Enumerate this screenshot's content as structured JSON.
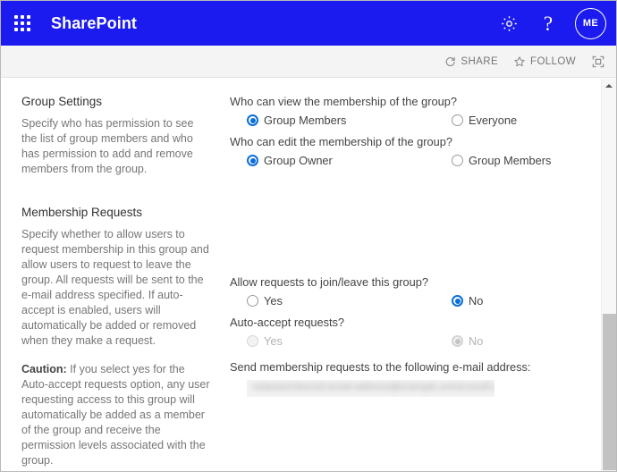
{
  "suite_bar": {
    "waffle_icon": "app-launcher-icon",
    "brand": "SharePoint",
    "settings_icon": "gear-icon",
    "help_icon": "question-mark-icon",
    "avatar_initials": "ME",
    "background_color": "#1b1bf0"
  },
  "command_bar": {
    "share_label": "SHARE",
    "share_icon": "share-icon",
    "follow_label": "FOLLOW",
    "follow_icon": "star-icon",
    "focus_icon": "focus-on-content-icon"
  },
  "sections": {
    "group_settings": {
      "title": "Group Settings",
      "description": "Specify who has permission to see the list of group members and who has permission to add and remove members from the group."
    },
    "membership_requests": {
      "title": "Membership Requests",
      "description": "Specify whether to allow users to request membership in this group and allow users to request to leave the group. All requests will be sent to the e-mail address specified. If auto-accept is enabled, users will automatically be added or removed when they make a request.",
      "caution_label": "Caution:",
      "caution_text": " If you select yes for the Auto-accept requests option, any user requesting access to this group will automatically be added as a member of the group and receive the permission levels associated with the group."
    }
  },
  "fields": {
    "view_membership": {
      "question": "Who can view the membership of the group?",
      "options": [
        {
          "label": "Group Members",
          "selected": true,
          "disabled": false
        },
        {
          "label": "Everyone",
          "selected": false,
          "disabled": false
        }
      ]
    },
    "edit_membership": {
      "question": "Who can edit the membership of the group?",
      "options": [
        {
          "label": "Group Owner",
          "selected": true,
          "disabled": false
        },
        {
          "label": "Group Members",
          "selected": false,
          "disabled": false
        }
      ]
    },
    "allow_requests": {
      "question": "Allow requests to join/leave this group?",
      "options": [
        {
          "label": "Yes",
          "selected": false,
          "disabled": false
        },
        {
          "label": "No",
          "selected": true,
          "disabled": false
        }
      ]
    },
    "auto_accept": {
      "question": "Auto-accept requests?",
      "options": [
        {
          "label": "Yes",
          "selected": false,
          "disabled": true
        },
        {
          "label": "No",
          "selected": true,
          "disabled": true
        }
      ]
    },
    "email": {
      "question": "Send membership requests to the following e-mail address:",
      "value": "redacted-blurred-email-address@example.onmicrosoft.com"
    }
  },
  "scrollbar": {
    "up_arrow_icon": "scroll-up-arrow-icon"
  },
  "colors": {
    "accent": "#1b1bf0",
    "radio_selected": "#0a6ed8",
    "text_primary": "#444444",
    "text_secondary": "#767676"
  }
}
